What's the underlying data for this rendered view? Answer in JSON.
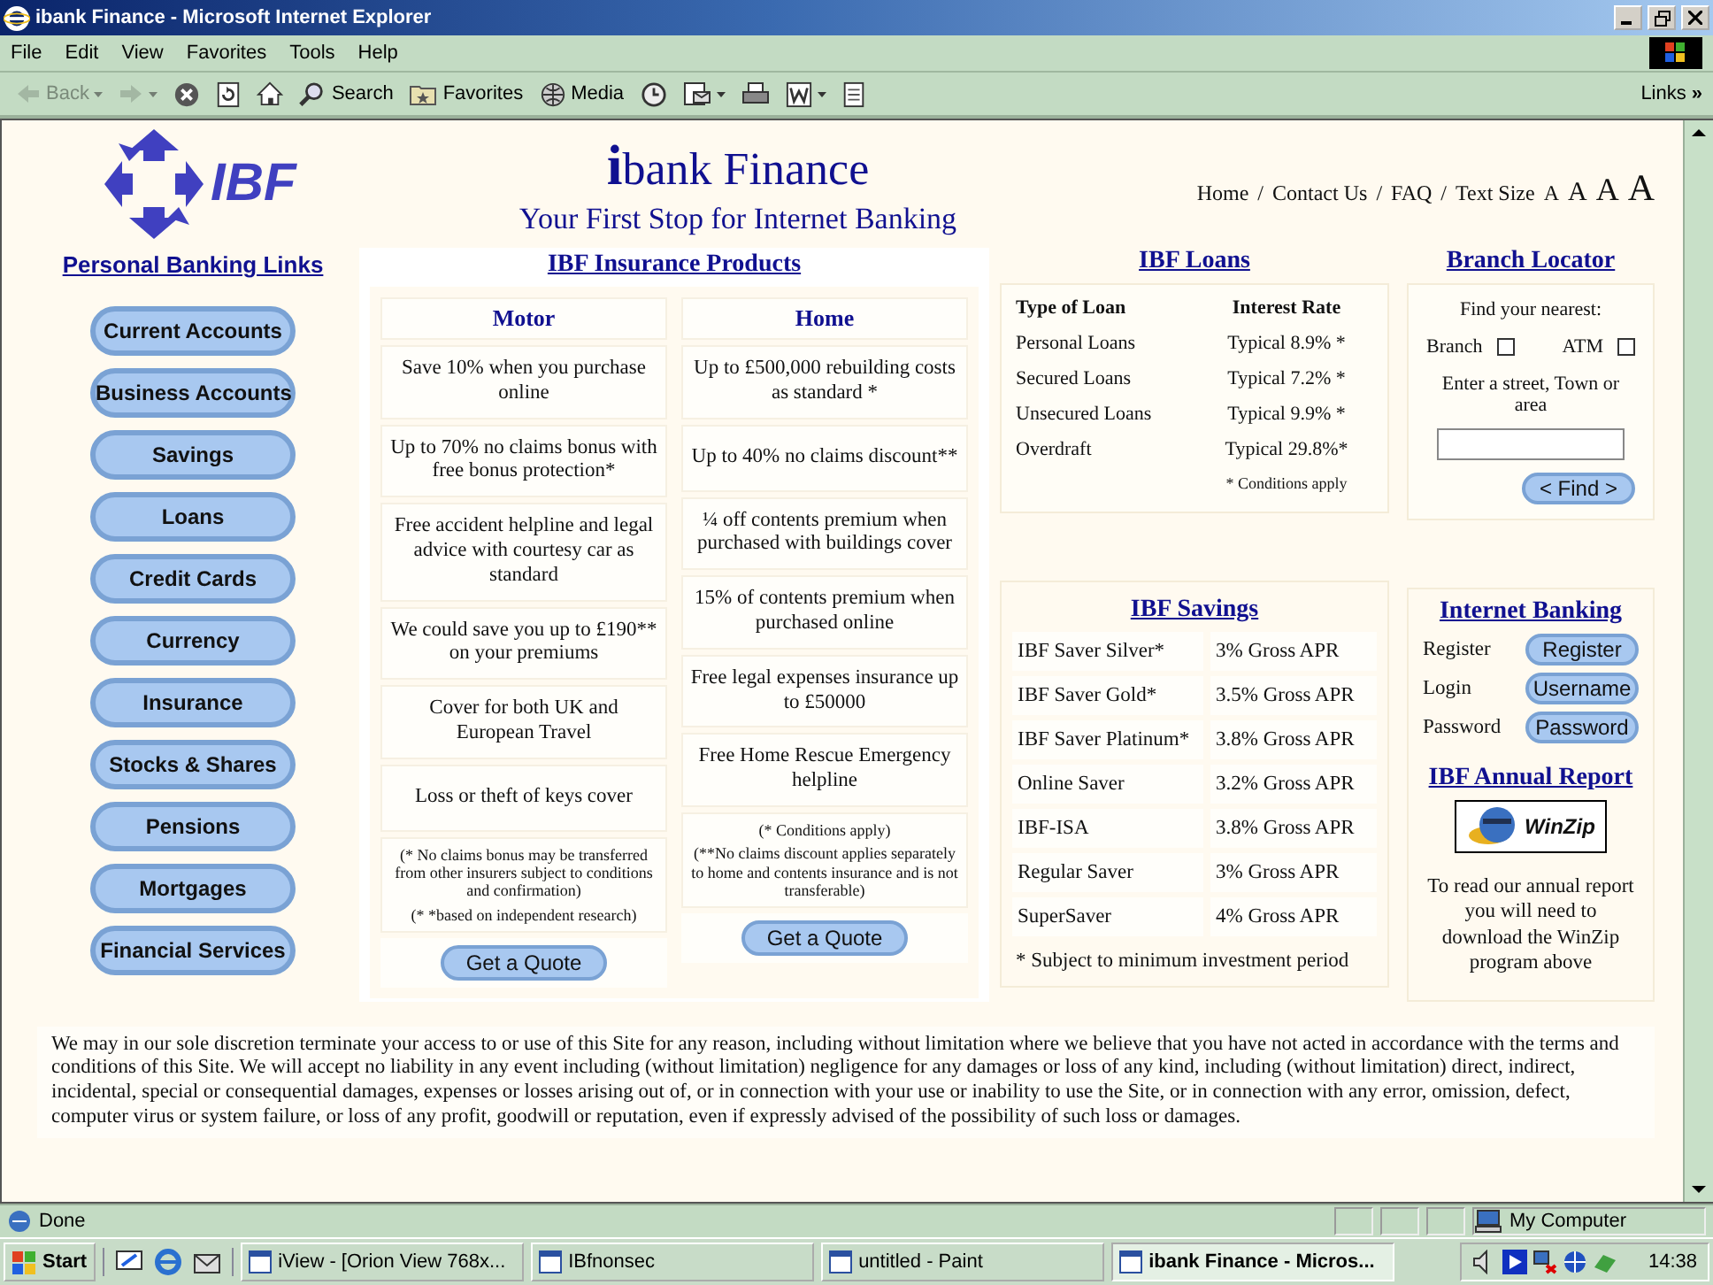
{
  "window": {
    "title": "ibank Finance - Microsoft Internet Explorer"
  },
  "menu": [
    "File",
    "Edit",
    "View",
    "Favorites",
    "Tools",
    "Help"
  ],
  "toolbar": [
    {
      "kind": "back",
      "label": "Back",
      "disabled": true,
      "dropdown": true
    },
    {
      "kind": "forward",
      "disabled": true,
      "dropdown": true
    },
    {
      "kind": "stop",
      "disabled": false,
      "dropdown": false
    },
    {
      "kind": "refresh",
      "disabled": false,
      "dropdown": false
    },
    {
      "kind": "home",
      "disabled": false,
      "dropdown": false
    },
    {
      "kind": "search",
      "label": "Search",
      "disabled": false,
      "dropdown": false
    },
    {
      "kind": "favorites",
      "label": "Favorites",
      "disabled": false,
      "dropdown": false
    },
    {
      "kind": "media",
      "label": "Media",
      "disabled": false,
      "dropdown": false
    },
    {
      "kind": "history",
      "disabled": false,
      "dropdown": false
    },
    {
      "kind": "mail",
      "disabled": false,
      "dropdown": true
    },
    {
      "kind": "print",
      "disabled": false,
      "dropdown": false
    },
    {
      "kind": "edit",
      "disabled": false,
      "dropdown": true
    },
    {
      "kind": "discuss",
      "disabled": false,
      "dropdown": false
    }
  ],
  "links": {
    "label": "Links",
    "chevron": "»"
  },
  "header": {
    "logo": "IBF",
    "title": "**i**bank Finance",
    "tagline": "Your First Stop for Internet Banking",
    "nav": [
      {
        "label": "Home",
        "separator": "/"
      },
      {
        "label": "Contact Us",
        "separator": "/"
      },
      {
        "label": "FAQ",
        "separator": "/"
      }
    ],
    "text_size": {
      "label": "Text Size",
      "options": [
        "A",
        "A",
        "A",
        "A"
      ]
    }
  },
  "sidebar": {
    "title": "Personal Banking Links",
    "items": [
      "Current Accounts",
      "Business Accounts",
      "Savings",
      "Loans",
      "Credit Cards",
      "Currency",
      "Insurance",
      "Stocks & Shares",
      "Pensions",
      "Mortgages",
      "Financial Services"
    ]
  },
  "insurance": {
    "title": "IBF Insurance Products",
    "columns": [
      {
        "heading": "Motor",
        "items": [
          "Save 10% when you purchase online",
          "Up to 70% no claims bonus with free bonus protection*",
          "Free accident helpline and legal advice with courtesy car as standard",
          "We could save you up to £190** on your premiums",
          "Cover for both UK and European Travel",
          "Loss or theft of keys cover"
        ],
        "notes": [
          "(* No claims bonus may be transferred from other insurers subject to conditions and confirmation)",
          "(* *based on independent research)"
        ],
        "button": "Get a Quote"
      },
      {
        "heading": "Home",
        "items": [
          "Up to £500,000 rebuilding costs as standard *",
          "Up to 40% no claims discount**",
          "¼ off contents premium when purchased with buildings cover",
          "15% of contents premium when purchased online",
          "Free legal expenses insurance up to £50000",
          "Free Home Rescue Emergency helpline"
        ],
        "notes": [
          "(* Conditions apply)",
          "(**No claims discount applies separately to home and contents insurance and is not transferable)"
        ],
        "button": "Get a Quote"
      }
    ]
  },
  "loans": {
    "title": "IBF Loans",
    "headers": [
      "Type of Loan",
      "Interest Rate"
    ],
    "rows": [
      [
        "Personal Loans",
        "Typical 8.9% *"
      ],
      [
        "Secured Loans",
        "Typical 7.2% *"
      ],
      [
        "Unsecured Loans",
        "Typical 9.9% *"
      ],
      [
        "Overdraft",
        "Typical 29.8%*"
      ]
    ],
    "footnote": "* Conditions apply"
  },
  "branch_locator": {
    "title": "Branch Locator",
    "prompt": "Find your nearest:",
    "options": [
      {
        "label": "Branch",
        "checked": false
      },
      {
        "label": "ATM",
        "checked": false
      }
    ],
    "street_label": "Enter a street, Town or area",
    "button": "< Find >"
  },
  "savings": {
    "title": "IBF Savings",
    "rows": [
      [
        "IBF Saver Silver*",
        "3% Gross APR"
      ],
      [
        "IBF Saver Gold*",
        "3.5% Gross APR"
      ],
      [
        "IBF Saver Platinum*",
        "3.8% Gross APR"
      ],
      [
        "Online Saver",
        "3.2% Gross APR"
      ],
      [
        "IBF-ISA",
        "3.8% Gross APR"
      ],
      [
        "Regular Saver",
        "3% Gross APR"
      ],
      [
        "SuperSaver",
        "4% Gross APR"
      ]
    ],
    "footnote": "* Subject to minimum investment period"
  },
  "internet_banking": {
    "title": "Internet Banking",
    "rows": [
      {
        "label": "Register",
        "button": "Register"
      },
      {
        "label": "Login",
        "button": "Username"
      },
      {
        "label": "Password",
        "button": "Password"
      }
    ]
  },
  "annual_report": {
    "title": "IBF Annual Report",
    "badge": "WinZip",
    "text": "To read our annual report you will need to download the WinZip program above"
  },
  "disclaimer": "We may in our sole discretion terminate your access to or use of this Site for any reason, including without limitation where we believe that you have not acted in accordance with the terms and conditions of this Site. We will accept no liability in any event including (without limitation) negligence for any damages or loss of any kind, including (without limitation) direct, indirect, incidental, special or consequential damages, expenses or losses arising out of, or in connection with your use or inability to use the Site, or in connection with any error, omission, defect, computer virus or system failure, or loss of any profit, goodwill or reputation, even if expressly advised of the possibility of such loss or damages.",
  "status_bar": {
    "text": "Done",
    "zone": "My Computer"
  },
  "taskbar": {
    "start": "Start",
    "tasks": [
      {
        "label": "iView - [Orion View  768x...",
        "selected": false
      },
      {
        "label": "IBfnonsec",
        "selected": false
      },
      {
        "label": "untitled - Paint",
        "selected": false
      },
      {
        "label": "ibank Finance - Micros...",
        "selected": true
      }
    ],
    "clock": "14:38"
  }
}
